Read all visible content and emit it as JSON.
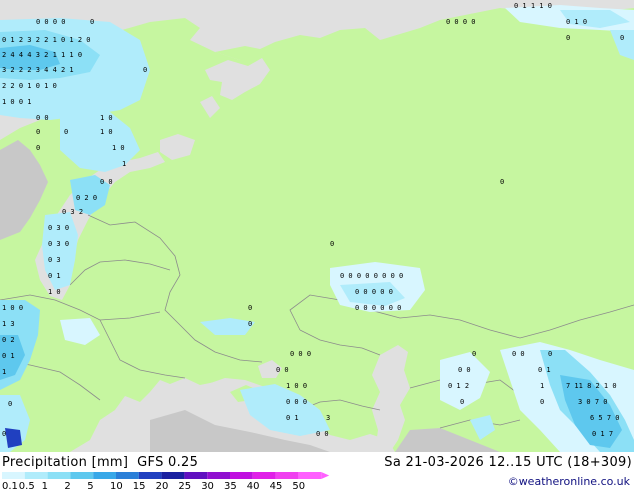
{
  "legend": {
    "title": "Precipitation [mm]",
    "model": "GFS 0.25",
    "ticks": [
      "0.1",
      "0.5",
      "1",
      "2",
      "5",
      "10",
      "15",
      "20",
      "25",
      "30",
      "35",
      "40",
      "45",
      "50"
    ],
    "colors": [
      "#d8f6ff",
      "#b0ecfb",
      "#8ce0f6",
      "#5ec8ee",
      "#38a8e8",
      "#2a7fd8",
      "#2040c0",
      "#1a20a0",
      "#6010c0",
      "#9010d0",
      "#c010e0",
      "#e020e8",
      "#f040f0",
      "#ff60ff"
    ]
  },
  "date_label": "Sa 21-03-2026 12..15 UTC (18+309)",
  "credit": "©weatheronline.co.uk",
  "map": {
    "colors": {
      "sea": "#e0e0e0",
      "land": "#c6f6a0",
      "nonforecast_land": "#c8c8c8",
      "border": "#8c8c8c"
    }
  }
}
